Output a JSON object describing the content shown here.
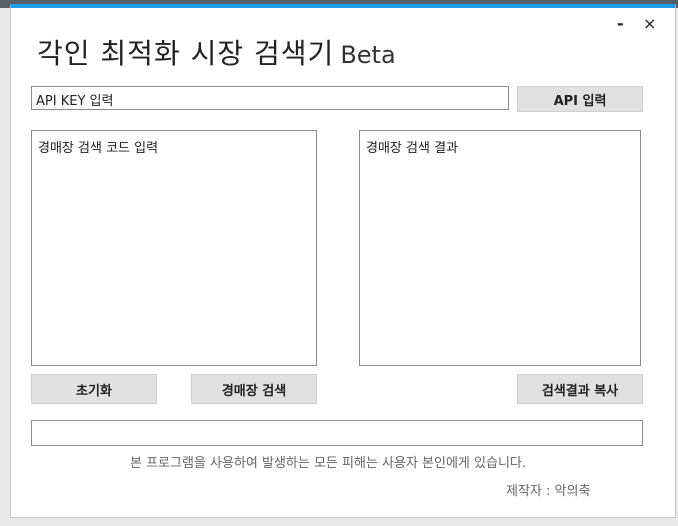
{
  "window": {
    "title": "각인 최적화 시장 검색기",
    "title_suffix": "Beta",
    "minimize_symbol": "-",
    "close_symbol": "×"
  },
  "api": {
    "input_value": "API KEY 입력",
    "button_label": "API 입력"
  },
  "left_panel": {
    "text": "경매장 검색 코드 입력"
  },
  "right_panel": {
    "text": "경매장 검색 결과"
  },
  "buttons": {
    "reset": "초기화",
    "search": "경매장 검색",
    "copy": "검색결과 복사"
  },
  "status_bar": {
    "value": ""
  },
  "footer": {
    "disclaimer": "본 프로그램을 사용하여 발생하는 모든 피해는 사용자 본인에게 있습니다.",
    "credit": "제작자 : 악의축"
  },
  "colors": {
    "accent": "#1e9ee6",
    "button_bg": "#e1e1e1",
    "border": "#8c8c8c"
  }
}
